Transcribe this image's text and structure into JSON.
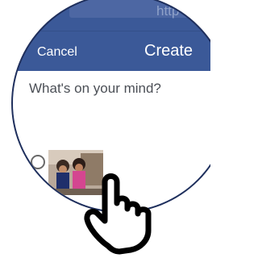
{
  "browser": {
    "url_fragment": "http"
  },
  "compose": {
    "cancel_label": "Cancel",
    "title": "Create",
    "placeholder": "What's on your mind?"
  },
  "icons": {
    "pointer": "hand-pointer-icon",
    "photo": "photo-icon"
  },
  "colors": {
    "header_blue": "#3b5998",
    "text_gray": "#4b4f56"
  }
}
